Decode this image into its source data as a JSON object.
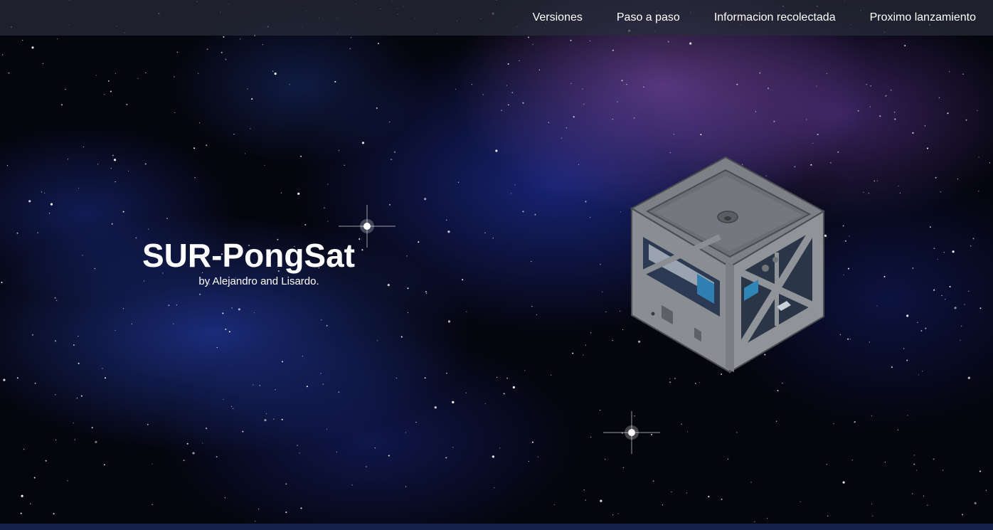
{
  "nav": {
    "items": [
      {
        "label": "Versiones"
      },
      {
        "label": "Paso a paso"
      },
      {
        "label": "Informacion recolectada"
      },
      {
        "label": "Proximo lanzamiento"
      }
    ]
  },
  "hero": {
    "title": "SUR-PongSat",
    "subtitle": "by Alejandro and Lisardo."
  },
  "colors": {
    "text": "#ffffff",
    "navbar_bg": "#282c3a",
    "bottom_bar": "#14204a"
  },
  "images": {
    "background": "space-nebula-starfield",
    "model": "pongsat-cube-3d-render"
  }
}
